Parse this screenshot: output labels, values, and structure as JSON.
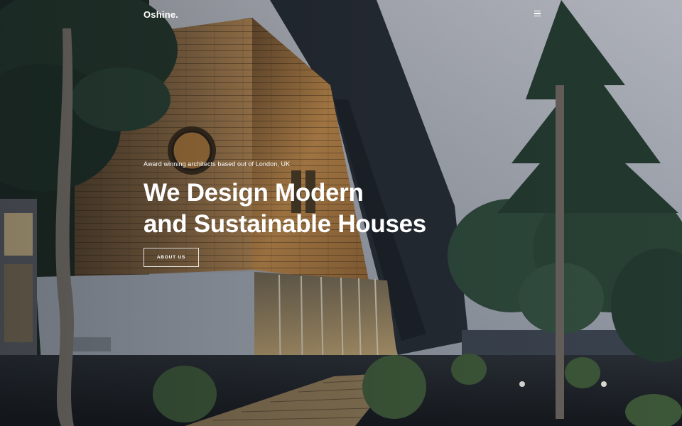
{
  "header": {
    "logo": "Oshine.",
    "menu_icon": "hamburger-menu-icon"
  },
  "hero": {
    "subtitle": "Award winning architects based out of London, UK",
    "headline_line1": "We Design Modern",
    "headline_line2": "and Sustainable Houses",
    "cta_label": "ABOUT US"
  },
  "colors": {
    "text": "#ffffff",
    "sky": "#9aa0aa",
    "dark_wall": "#2b313b",
    "wood": "#8a6a45",
    "foliage": "#2f4a3c"
  }
}
